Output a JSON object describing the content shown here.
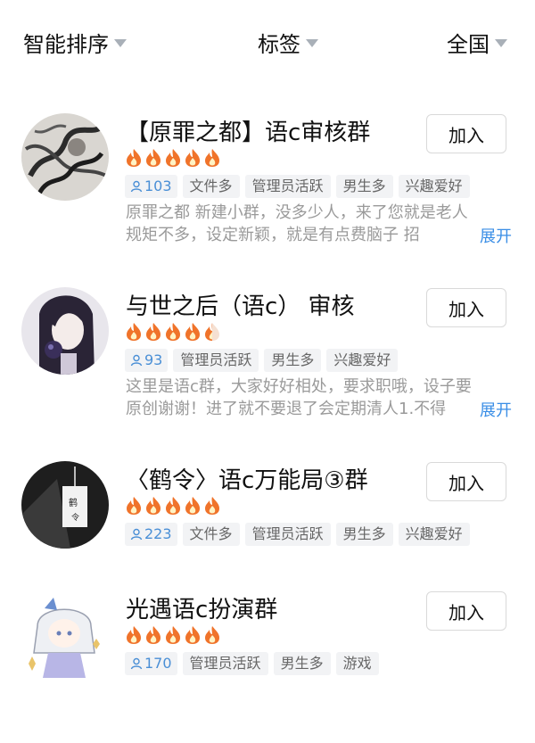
{
  "filters": {
    "sort": "智能排序",
    "tag": "标签",
    "region": "全国"
  },
  "colors": {
    "flame": "#f0732a",
    "member_count": "#4a8fd6",
    "expand_link": "#3a8ee6"
  },
  "icons": {
    "dropdown": "chevron-down-icon",
    "member": "person-icon",
    "heat": "flame-icon"
  },
  "groups": [
    {
      "name": "【原罪之都】语c审核群",
      "heat": 5,
      "members": "103",
      "tags": [
        "文件多",
        "管理员活跃",
        "男生多",
        "兴趣爱好"
      ],
      "desc_line1": "原罪之都 新建小群，没多少人，来了您就是老人",
      "desc_line2": "规矩不多，设定新颖，就是有点费脑子 招",
      "expand": "展开",
      "join": "加入"
    },
    {
      "name": "与世之后（语c） 审核",
      "heat": 4.5,
      "members": "93",
      "tags": [
        "管理员活跃",
        "男生多",
        "兴趣爱好"
      ],
      "desc_line1": "这里是语c群，大家好好相处，要求职哦，设子要",
      "desc_line2": "原创谢谢！进了就不要退了会定期清人1.不得",
      "expand": "展开",
      "join": "加入"
    },
    {
      "name": "〈鹤令〉语c万能局③群",
      "heat": 5,
      "members": "223",
      "tags": [
        "文件多",
        "管理员活跃",
        "男生多",
        "兴趣爱好"
      ],
      "join": "加入"
    },
    {
      "name": "光遇语c扮演群",
      "heat": 5,
      "members": "170",
      "tags": [
        "管理员活跃",
        "男生多",
        "游戏"
      ],
      "join": "加入"
    }
  ]
}
